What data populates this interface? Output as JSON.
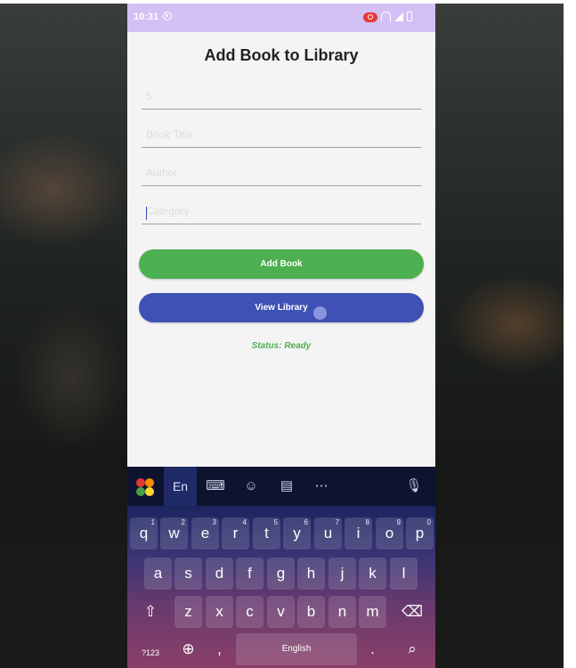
{
  "status_bar": {
    "time": "10:31"
  },
  "page": {
    "title": "Add Book to Library"
  },
  "form": {
    "fields": [
      {
        "name": "book-id-field",
        "placeholder": "5",
        "value": ""
      },
      {
        "name": "book-title-field",
        "placeholder": "Book Title",
        "value": ""
      },
      {
        "name": "author-field",
        "placeholder": "Author",
        "value": ""
      },
      {
        "name": "category-field",
        "placeholder": "Category",
        "value": ""
      }
    ],
    "add_label": "Add Book",
    "view_label": "View Library",
    "status_text": "Status: Ready"
  },
  "colors": {
    "status_bar": "#d3c0f5",
    "add_button": "#4caf50",
    "view_button": "#3f51b5",
    "status_text": "#4caf50"
  },
  "keyboard": {
    "language": "En",
    "toolbar_icons": [
      "app-logo-icon",
      "keyboard-layout-icon",
      "emoji-icon",
      "clipboard-icon",
      "more-icon",
      "microphone-icon"
    ],
    "row1": [
      {
        "k": "q",
        "n": "1"
      },
      {
        "k": "w",
        "n": "2"
      },
      {
        "k": "e",
        "n": "3"
      },
      {
        "k": "r",
        "n": "4"
      },
      {
        "k": "t",
        "n": "5"
      },
      {
        "k": "y",
        "n": "6"
      },
      {
        "k": "u",
        "n": "7"
      },
      {
        "k": "i",
        "n": "8"
      },
      {
        "k": "o",
        "n": "9"
      },
      {
        "k": "p",
        "n": "0"
      }
    ],
    "row2": [
      "a",
      "s",
      "d",
      "f",
      "g",
      "h",
      "j",
      "k",
      "l"
    ],
    "row3": [
      "z",
      "x",
      "c",
      "v",
      "b",
      "n",
      "m"
    ],
    "symbols_label": "?123",
    "comma": ",",
    "space_label": "English",
    "period": "."
  }
}
